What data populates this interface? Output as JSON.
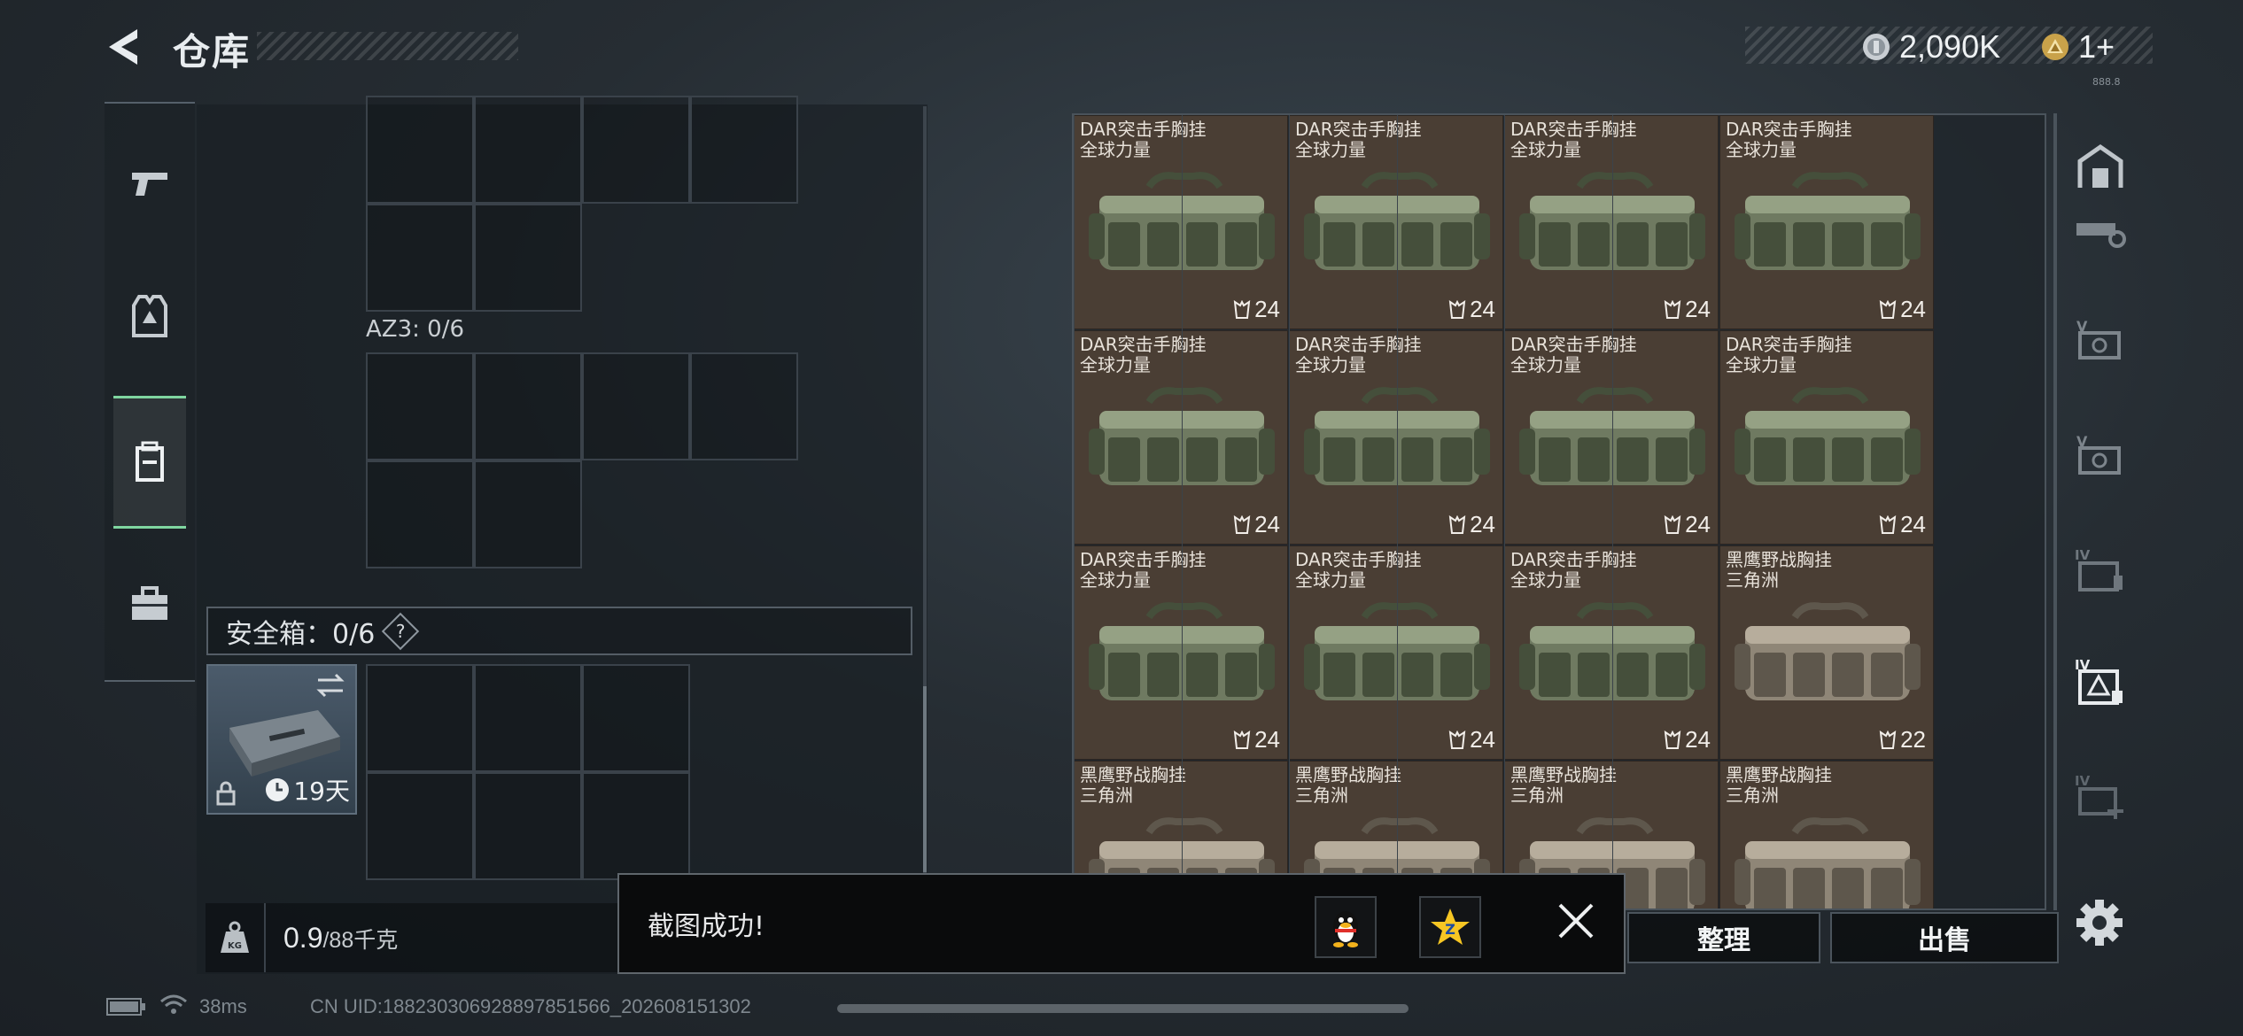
{
  "header": {
    "title": "仓库",
    "currency": [
      {
        "icon": "silver-coin-icon",
        "value": "2,090K"
      },
      {
        "icon": "gold-triangle-coin-icon",
        "value": "1+"
      }
    ],
    "currency_sub": "888.8"
  },
  "nav": {
    "items": [
      {
        "name": "weapons",
        "icon": "pistol-icon"
      },
      {
        "name": "armor",
        "icon": "vest-icon"
      },
      {
        "name": "backpack",
        "icon": "backpack-icon",
        "active": true
      },
      {
        "name": "supplies",
        "icon": "briefcase-icon"
      }
    ]
  },
  "loadout": {
    "az3_label": "AZ3: 0/6",
    "safe_box_label": "安全箱：0/6",
    "help": "?",
    "case_days": "19天",
    "weight_value": "0.9",
    "weight_max": "/88千克"
  },
  "stash": {
    "items": [
      {
        "line1": "DAR突击手胸挂",
        "line2": "全球力量",
        "count": "24",
        "tone": "green"
      },
      {
        "line1": "DAR突击手胸挂",
        "line2": "全球力量",
        "count": "24",
        "tone": "green"
      },
      {
        "line1": "DAR突击手胸挂",
        "line2": "全球力量",
        "count": "24",
        "tone": "green"
      },
      {
        "line1": "DAR突击手胸挂",
        "line2": "全球力量",
        "count": "24",
        "tone": "green"
      },
      {
        "line1": "DAR突击手胸挂",
        "line2": "全球力量",
        "count": "24",
        "tone": "green"
      },
      {
        "line1": "DAR突击手胸挂",
        "line2": "全球力量",
        "count": "24",
        "tone": "green"
      },
      {
        "line1": "DAR突击手胸挂",
        "line2": "全球力量",
        "count": "24",
        "tone": "green"
      },
      {
        "line1": "DAR突击手胸挂",
        "line2": "全球力量",
        "count": "24",
        "tone": "green"
      },
      {
        "line1": "DAR突击手胸挂",
        "line2": "全球力量",
        "count": "24",
        "tone": "green"
      },
      {
        "line1": "DAR突击手胸挂",
        "line2": "全球力量",
        "count": "24",
        "tone": "green"
      },
      {
        "line1": "DAR突击手胸挂",
        "line2": "全球力量",
        "count": "24",
        "tone": "green"
      },
      {
        "line1": "黑鹰野战胸挂",
        "line2": "三角洲",
        "count": "22",
        "tone": "tan"
      },
      {
        "line1": "黑鹰野战胸挂",
        "line2": "三角洲",
        "count": "",
        "tone": "tan"
      },
      {
        "line1": "黑鹰野战胸挂",
        "line2": "三角洲",
        "count": "",
        "tone": "tan"
      },
      {
        "line1": "黑鹰野战胸挂",
        "line2": "三角洲",
        "count": "",
        "tone": "tan"
      },
      {
        "line1": "黑鹰野战胸挂",
        "line2": "三角洲",
        "count": "",
        "tone": "tan"
      }
    ],
    "sort_button": "整理",
    "sell_button": "出售"
  },
  "tools": [
    {
      "icon": "vault-icon"
    },
    {
      "icon": "key-icon"
    },
    {
      "icon": "v-safe-icon"
    },
    {
      "icon": "v-safe-icon-2"
    },
    {
      "icon": "iv-folder-icon"
    },
    {
      "icon": "iv-triangle-lock-icon"
    },
    {
      "icon": "iv-add-icon"
    }
  ],
  "toast": {
    "message": "截图成功!",
    "qq_icon": "qq-penguin-icon",
    "zone_icon": "qzone-star-icon"
  },
  "status": {
    "ping": "38ms",
    "uid": "CN UID:1882303069288978515​66_202608151302"
  },
  "colors": {
    "accent_green": "#7fd6a0",
    "item_bg": "#4a3e34"
  }
}
